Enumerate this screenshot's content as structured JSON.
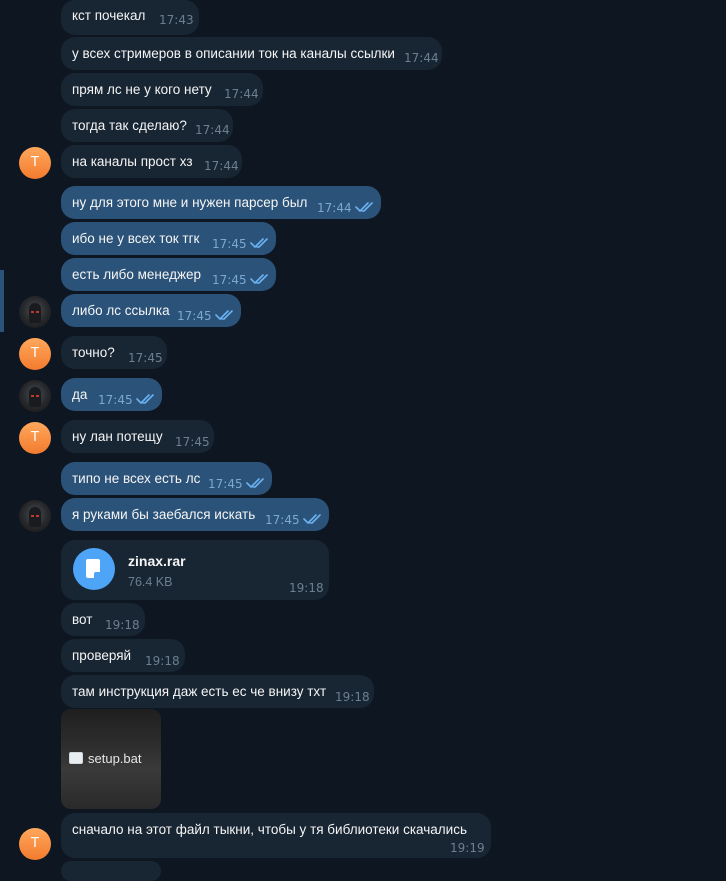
{
  "messages": [
    {
      "text": "кст почекал",
      "time": "17:43"
    },
    {
      "text": "у всех стримеров в описании ток на каналы ссылки",
      "time": "17:44"
    },
    {
      "text": "прям лс не у кого нету",
      "time": "17:44"
    },
    {
      "text": "тогда так сделаю?",
      "time": "17:44"
    },
    {
      "text": "на каналы прост хз",
      "time": "17:44",
      "avatar": "Т"
    },
    {
      "text": "ну для этого мне и нужен парсер был",
      "time": "17:44"
    },
    {
      "text": "ибо не у всех ток тгк",
      "time": "17:45"
    },
    {
      "text": "есть либо менеджер",
      "time": "17:45"
    },
    {
      "text": "либо лс ссылка",
      "time": "17:45"
    },
    {
      "text": "точно?",
      "time": "17:45",
      "avatar": "Т"
    },
    {
      "text": "да",
      "time": "17:45"
    },
    {
      "text": "ну лан потещу",
      "time": "17:45",
      "avatar": "Т"
    },
    {
      "text": "типо не всех есть лс",
      "time": "17:45"
    },
    {
      "text": "я руками бы заебался искать",
      "time": "17:45"
    },
    {
      "text": "вот",
      "time": "19:18"
    },
    {
      "text": "проверяй",
      "time": "19:18"
    },
    {
      "text": "там инструкция даж есть ес че внизу тхт",
      "time": "19:18"
    },
    {
      "text": "сначало на этот файл тыкни, чтобы у тя библиотеки скачались",
      "time": "19:19",
      "avatar": "Т"
    }
  ],
  "file": {
    "name": "zinax.rar",
    "size": "76.4 KB",
    "time": "19:18"
  },
  "media": {
    "filename": "setup.bat"
  },
  "colors": {
    "incoming": "#182533",
    "outgoing": "#2b5278",
    "background": "#0e1621",
    "avatar_accent": "#f37b2e",
    "read_ticks": "#6ab2f2"
  }
}
